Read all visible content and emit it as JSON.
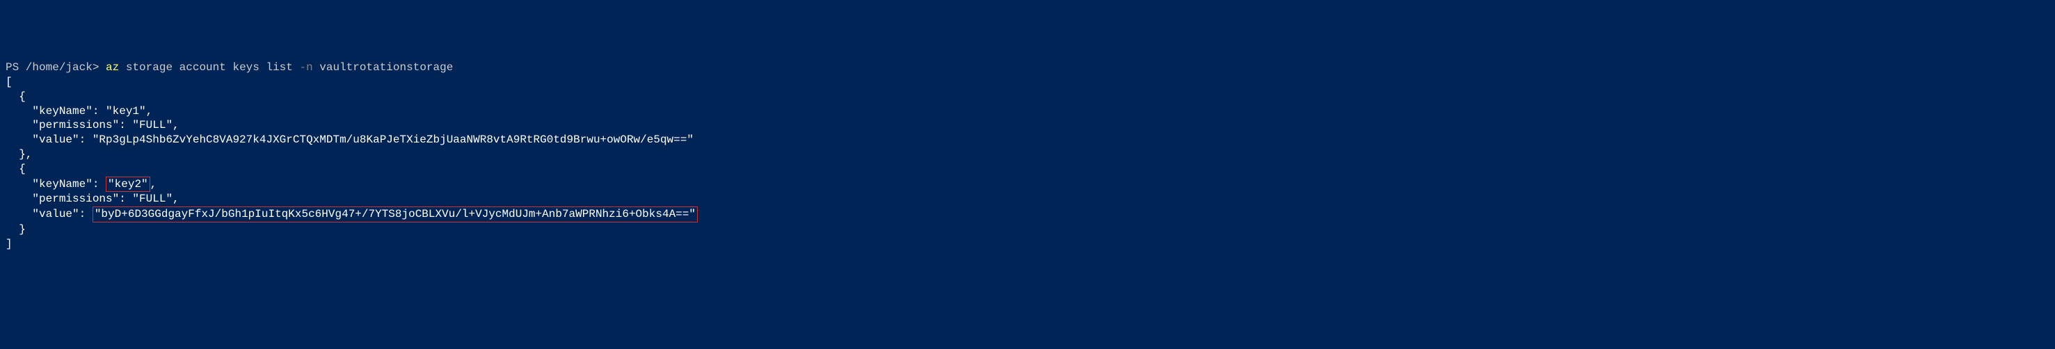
{
  "prompt": {
    "prefix": "PS /home/jack> ",
    "command": "az",
    "args": " storage account keys list ",
    "flag": "-n",
    "argValue": " vaultrotationstorage"
  },
  "output": {
    "line1": "[",
    "line2": "  {",
    "line3": "    \"keyName\": \"key1\",",
    "line4": "    \"permissions\": \"FULL\",",
    "line5": "    \"value\": \"Rp3gLp4Shb6ZvYehC8VA927k4JXGrCTQxMDTm/u8KaPJeTXieZbjUaaNWR8vtA9RtRG0td9Brwu+owORw/e5qw==\"",
    "line6": "  },",
    "line7": "  {",
    "line8_prefix": "    \"keyName\": ",
    "line8_highlight": "\"key2\"",
    "line8_suffix": ",",
    "line9": "    \"permissions\": \"FULL\",",
    "line10_prefix": "    \"value\": ",
    "line10_highlight": "\"byD+6D3GGdgayFfxJ/bGh1pIuItqKx5c6HVg47+/7YTS8joCBLXVu/l+VJycMdUJm+Anb7aWPRNhzi6+Obks4A==\"",
    "line11": "  }",
    "line12": "]"
  }
}
